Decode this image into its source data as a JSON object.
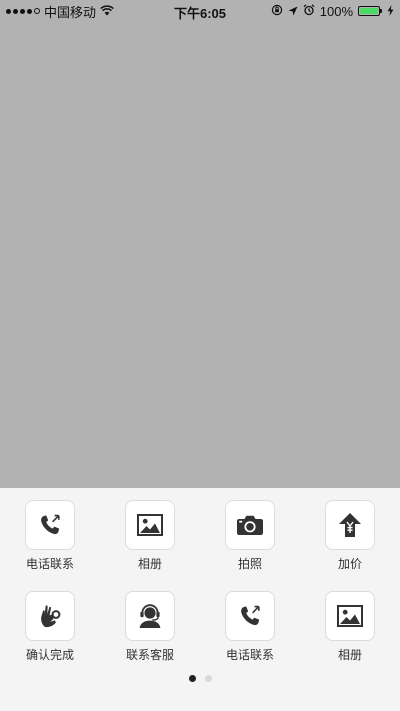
{
  "status_bar": {
    "carrier": "中国移动",
    "time": "下午6:05",
    "battery_text": "100%",
    "battery_level": 1.0,
    "signal_bars_filled": 4,
    "signal_bars_total": 5,
    "battery_color": "#4cd964"
  },
  "panel": {
    "items": [
      {
        "label": "电话联系",
        "icon": "phone-icon"
      },
      {
        "label": "相册",
        "icon": "photo-album-icon"
      },
      {
        "label": "拍照",
        "icon": "camera-icon"
      },
      {
        "label": "加价",
        "icon": "yuan-up-arrow-icon"
      },
      {
        "label": "确认完成",
        "icon": "ok-hand-icon"
      },
      {
        "label": "联系客服",
        "icon": "customer-service-headset-icon"
      },
      {
        "label": "电话联系",
        "icon": "phone-icon"
      },
      {
        "label": "相册",
        "icon": "photo-album-icon"
      }
    ],
    "pager": {
      "current_page": 1,
      "total_pages": 2
    }
  }
}
